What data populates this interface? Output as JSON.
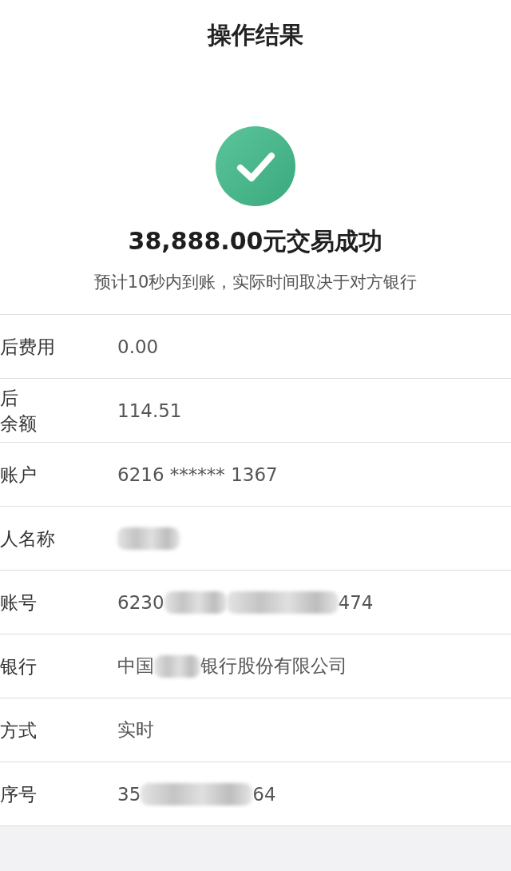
{
  "header": {
    "title": "操作结果"
  },
  "result": {
    "succeeded": true,
    "amount": "38,888.00元交易成功",
    "note": "预计10秒内到账，实际时间取决于对方银行"
  },
  "details": [
    {
      "label_lines": [
        "后费用"
      ],
      "value_parts": [
        {
          "kind": "text",
          "text": "0.00"
        }
      ]
    },
    {
      "label_lines": [
        "后",
        "余额"
      ],
      "value_parts": [
        {
          "kind": "text",
          "text": "114.51"
        }
      ]
    },
    {
      "label_lines": [
        "账户"
      ],
      "value_parts": [
        {
          "kind": "text",
          "text": "6216 ****** 1367"
        }
      ]
    },
    {
      "label_lines": [
        "人名称"
      ],
      "value_parts": [
        {
          "kind": "blur_medium"
        }
      ]
    },
    {
      "label_lines": [
        "账号"
      ],
      "value_parts": [
        {
          "kind": "text",
          "text": "6230"
        },
        {
          "kind": "blur_medium"
        },
        {
          "kind": "blur_long"
        },
        {
          "kind": "text",
          "text": "474"
        }
      ]
    },
    {
      "label_lines": [
        "银行"
      ],
      "value_parts": [
        {
          "kind": "text",
          "text": "中国"
        },
        {
          "kind": "blur_short"
        },
        {
          "kind": "text",
          "text": "银行股份有限公司"
        }
      ]
    },
    {
      "label_lines": [
        "方式"
      ],
      "value_parts": [
        {
          "kind": "text",
          "text": "实时"
        }
      ]
    },
    {
      "label_lines": [
        "序号"
      ],
      "value_parts": [
        {
          "kind": "text",
          "text": "35"
        },
        {
          "kind": "blur_long"
        },
        {
          "kind": "text",
          "text": "64"
        }
      ]
    }
  ]
}
